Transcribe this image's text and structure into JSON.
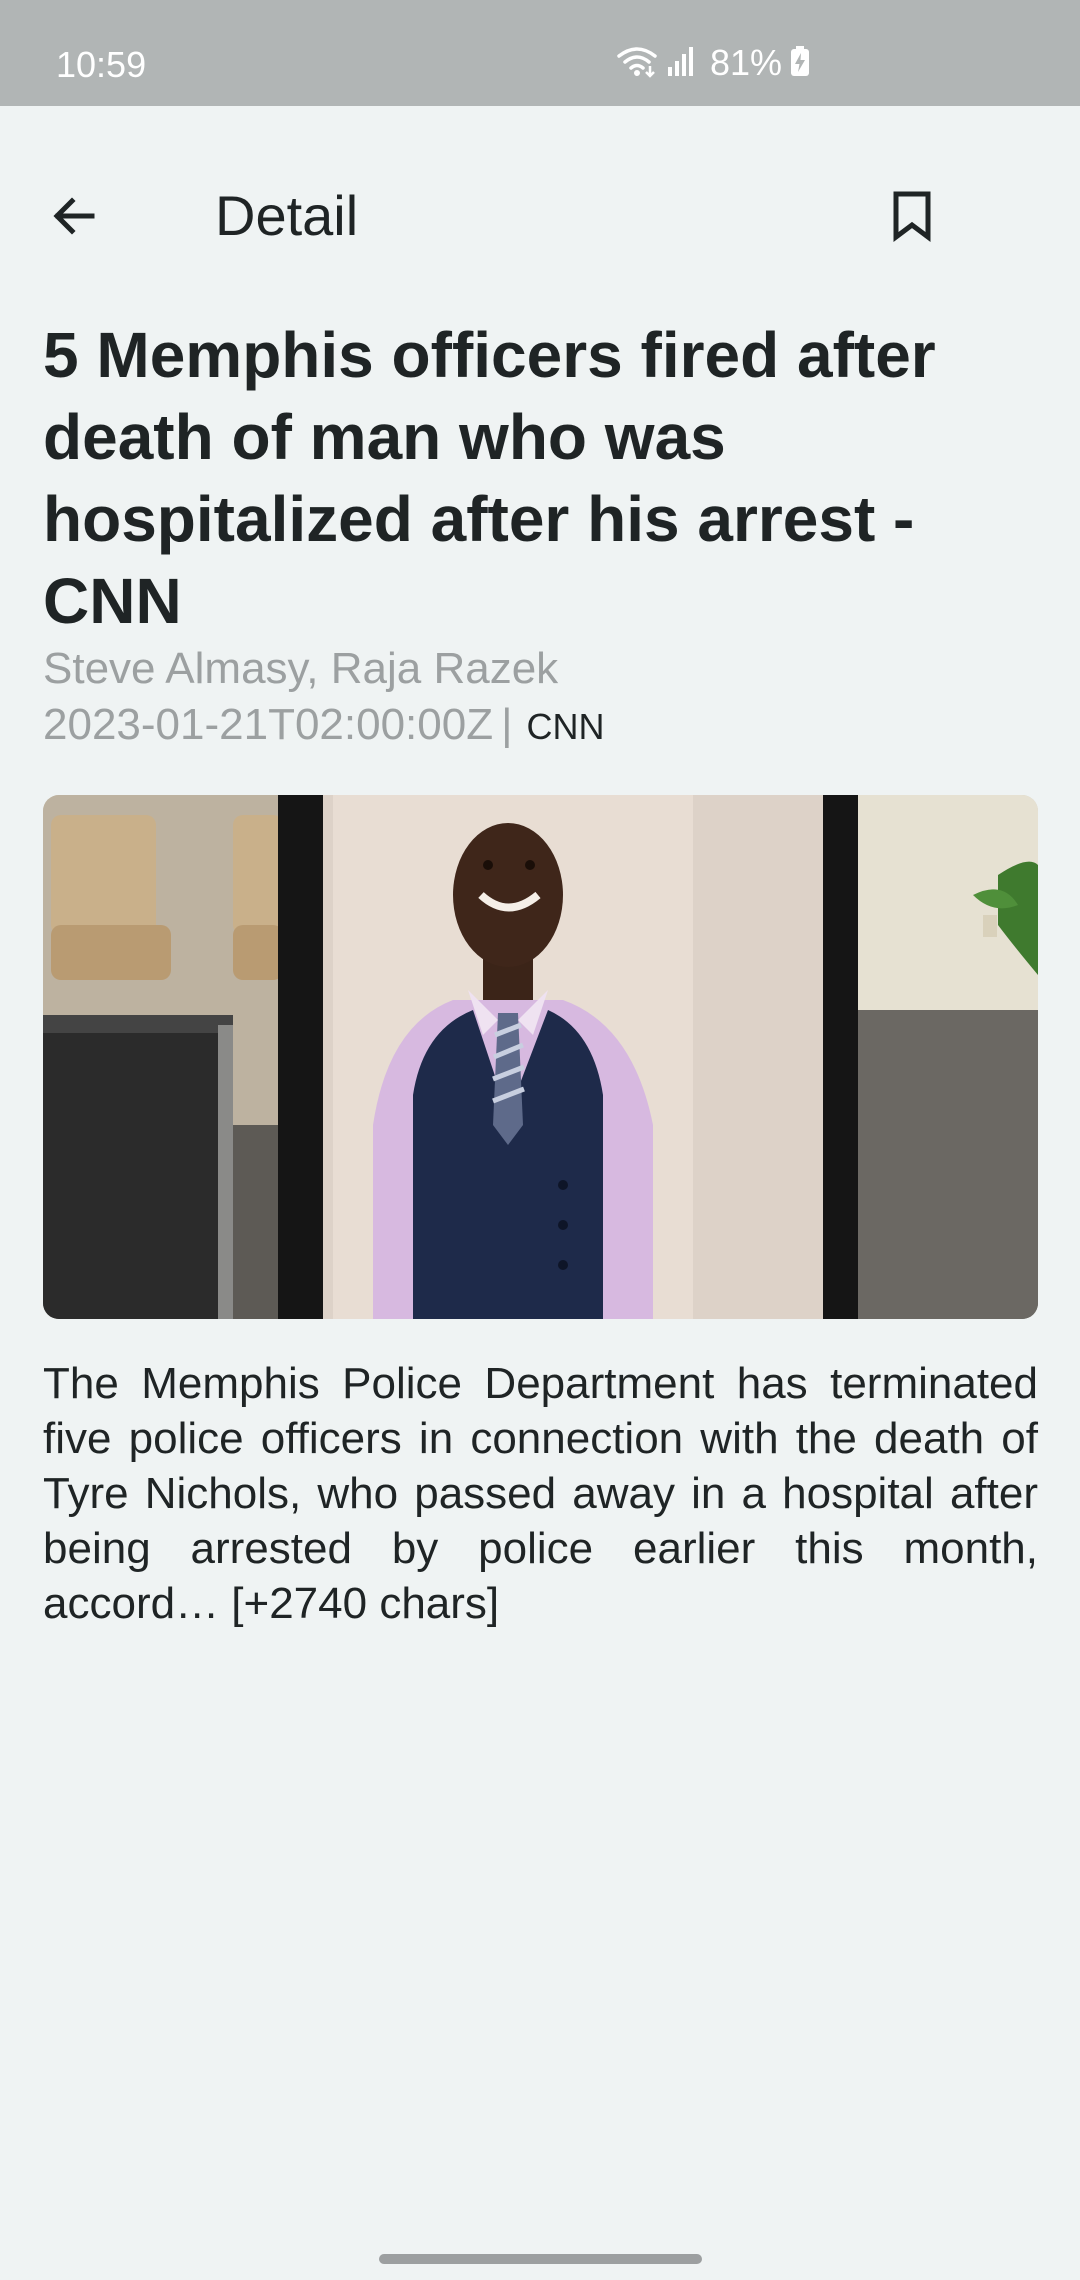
{
  "status_bar": {
    "time": "10:59",
    "battery": "81%",
    "icons": [
      "wifi-icon",
      "signal-icon",
      "battery-charging-icon"
    ]
  },
  "app_bar": {
    "title": "Detail",
    "back_icon": "arrow-left-icon",
    "bookmark_icon": "bookmark-outline-icon"
  },
  "article": {
    "title": "5 Memphis officers fired after death of man who was hospitalized after his arrest - CNN",
    "authors": "Steve Almasy, Raja Razek",
    "published_at": "2023-01-21T02:00:00Z",
    "separator": "|",
    "source": "CNN",
    "image_alt": "Framed portrait of a smiling man in a lavender shirt, striped tie and navy vest",
    "description": "The Memphis Police Department has terminated five police officers in connection with the death of Tyre Nichols, who passed away in a hospital after being arrested by police earlier this month, accord… [+2740 chars]"
  },
  "colors": {
    "background": "#eff3f3",
    "status_bar": "#b1b5b5",
    "text_primary": "#1f2425",
    "text_secondary": "#9ca0a1"
  }
}
